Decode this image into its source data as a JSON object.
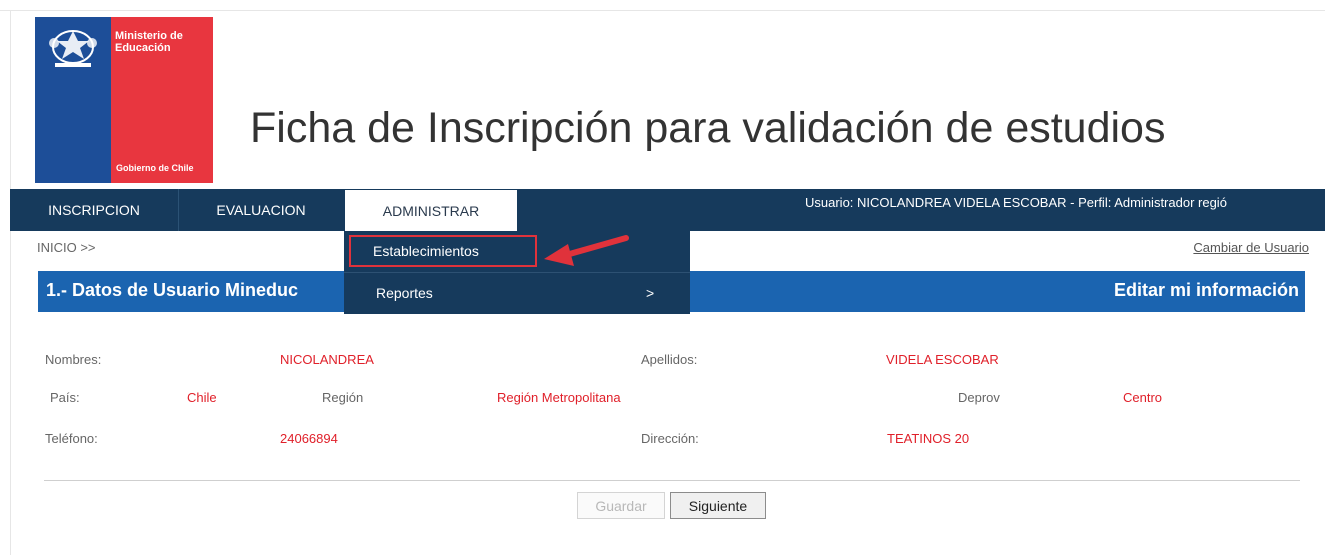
{
  "logo": {
    "ministry": "Ministerio de Educación",
    "government": "Gobierno de Chile"
  },
  "header": {
    "title": "Ficha de Inscripción para validación de estudios"
  },
  "nav": {
    "tabs": [
      "INSCRIPCION",
      "EVALUACION",
      "ADMINISTRAR"
    ],
    "user_info": "Usuario: NICOLANDREA VIDELA ESCOBAR - Perfil: Administrador regió"
  },
  "dropdown": {
    "items": [
      "Establecimientos",
      "Reportes"
    ],
    "submenu_arrow": ">"
  },
  "breadcrumb": "INICIO >>",
  "change_user": "Cambiar de Usuario",
  "section": {
    "title": "1.- Datos de Usuario Mineduc",
    "edit_link": "Editar mi información"
  },
  "fields": {
    "nombres_label": "Nombres:",
    "nombres_value": "NICOLANDREA",
    "apellidos_label": "Apellidos:",
    "apellidos_value": "VIDELA ESCOBAR",
    "pais_label": "País:",
    "pais_value": "Chile",
    "region_label": "Región",
    "region_value": "Región Metropolitana",
    "deprov_label": "Deprov",
    "deprov_value": "Centro",
    "telefono_label": "Teléfono:",
    "telefono_value": "24066894",
    "direccion_label": "Dirección:",
    "direccion_value": "TEATINOS 20"
  },
  "buttons": {
    "save": "Guardar",
    "next": "Siguiente"
  },
  "colors": {
    "nav": "#163a5c",
    "section": "#1b64b0",
    "value_text": "#e0202a",
    "logo_red": "#e8363f",
    "logo_blue": "#1d4e98",
    "annotation": "#e0323b"
  }
}
